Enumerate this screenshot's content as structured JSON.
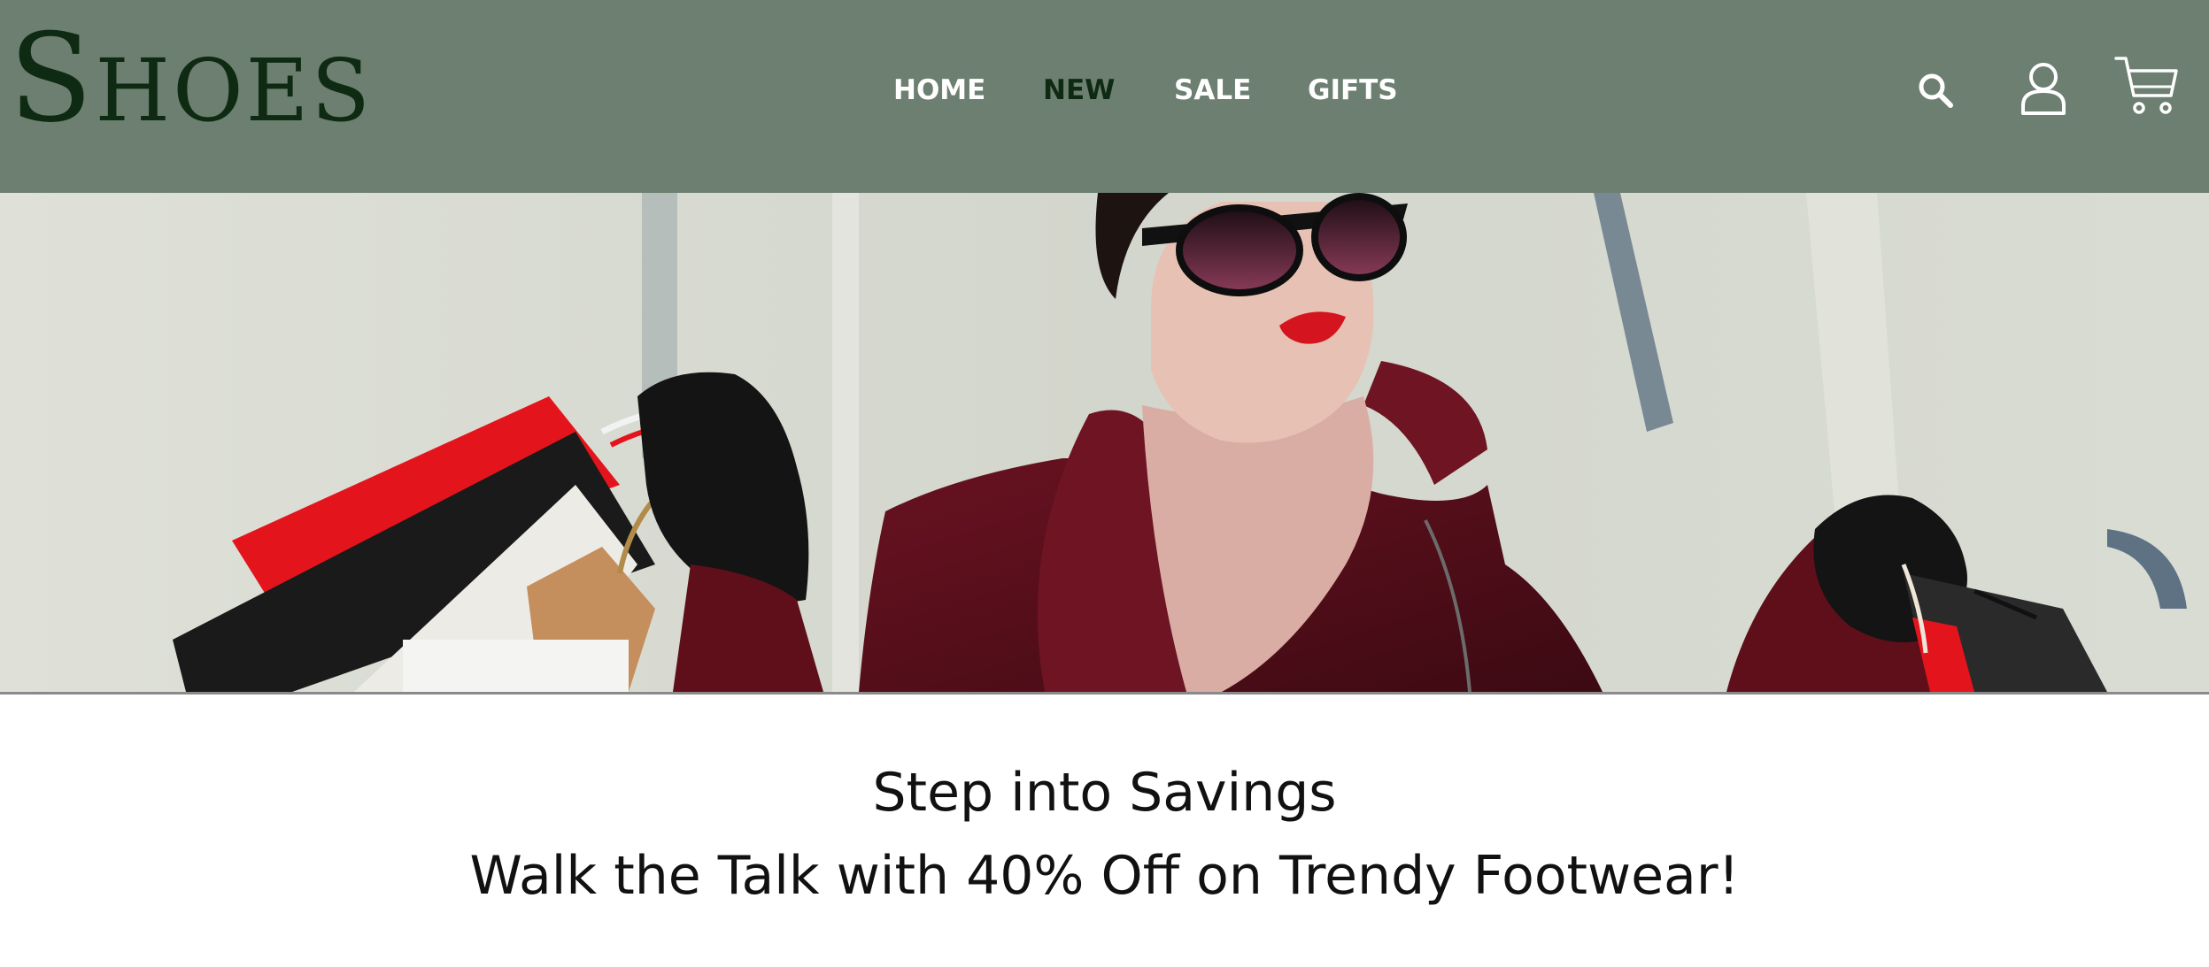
{
  "brand": {
    "logo_text": "Shoes",
    "logo_color": "#0f2a12"
  },
  "header": {
    "background_color": "#6c7f70",
    "nav": [
      {
        "label": "HOME",
        "active": false
      },
      {
        "label": "NEW",
        "active": true
      },
      {
        "label": "SALE",
        "active": false
      },
      {
        "label": "GIFTS",
        "active": false
      }
    ],
    "icons": [
      "search-icon",
      "user-icon",
      "cart-icon"
    ]
  },
  "hero": {
    "image_subject": "woman in sunglasses and burgundy coat holding shopping bags",
    "accent_colors": {
      "coat": "#5e0f1a",
      "lips": "#d4141f",
      "bag_red": "#e4141c",
      "wall": "#d9dcd2"
    }
  },
  "promo": {
    "title": "Step into Savings",
    "subtitle": "Walk the Talk with 40% Off on Trendy Footwear!"
  }
}
